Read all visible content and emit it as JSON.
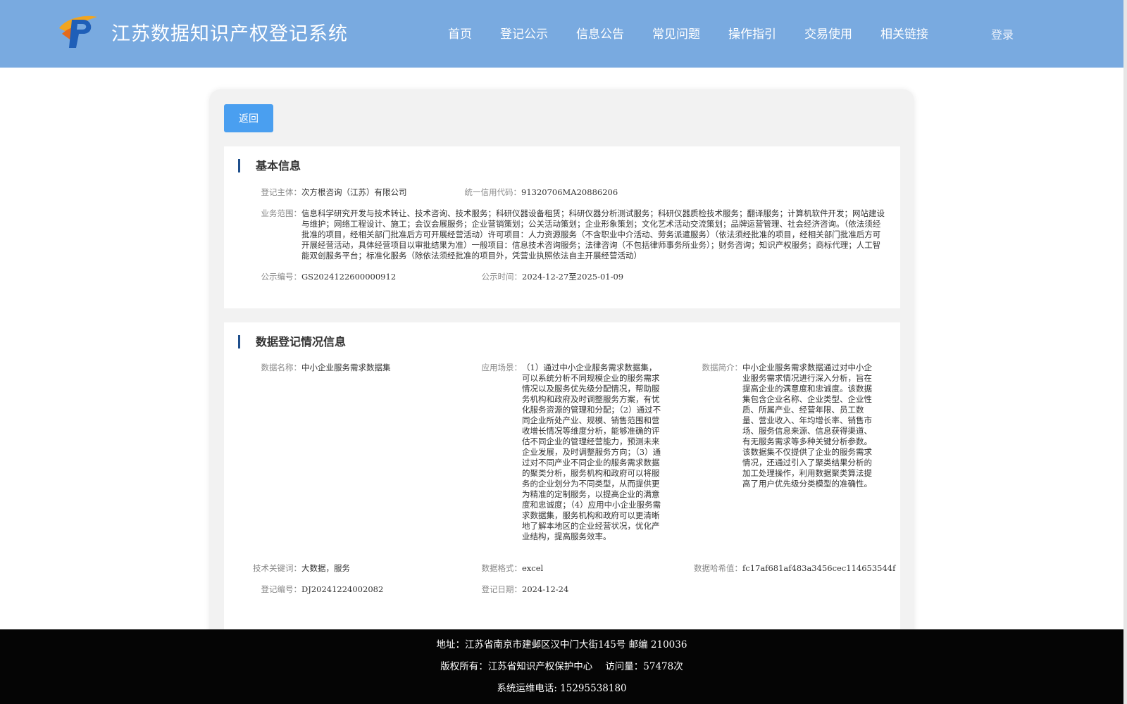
{
  "header": {
    "site_title": "江苏数据知识产权登记系统",
    "nav": [
      "首页",
      "登记公示",
      "信息公告",
      "常见问题",
      "操作指引",
      "交易使用",
      "相关链接"
    ],
    "login_label": "登录"
  },
  "actions": {
    "back_label": "返回"
  },
  "basic_info": {
    "title": "基本信息",
    "entity_label": "登记主体：",
    "entity_value": "次方根咨询（江苏）有限公司",
    "credit_code_label": "统一信用代码：",
    "credit_code_value": "91320706MA20886206",
    "scope_label": "业务范围：",
    "scope_value": "信息科学研究开发与技术转让、技术咨询、技术服务；科研仪器设备租赁；科研仪器分析测试服务；科研仪器质检技术服务；翻译服务；计算机软件开发；网站建设与维护；网络工程设计、施工；会议会展服务；企业营销策划；公关活动策划；企业形象策划；文化艺术活动交流策划；品牌运营管理、社会经济咨询。（依法须经批准的项目，经相关部门批准后方可开展经营活动）许可项目：人力资源服务（不含职业中介活动、劳务派遣服务）（依法须经批准的项目，经相关部门批准后方可开展经营活动，具体经营项目以审批结果为准）一般项目：信息技术咨询服务；法律咨询（不包括律师事务所业务）；财务咨询；知识产权服务；商标代理；人工智能双创服务平台；标准化服务（除依法须经批准的项目外，凭营业执照依法自主开展经营活动）",
    "notice_no_label": "公示编号：",
    "notice_no_value": "GS2024122600000912",
    "notice_time_label": "公示时间：",
    "notice_time_value": "2024-12-27至2025-01-09"
  },
  "data_info": {
    "title": "数据登记情况信息",
    "name_label": "数据名称：",
    "name_value": "中小企业服务需求数据集",
    "scenario_label": "应用场景：",
    "scenario_value": "（1）通过中小企业服务需求数据集，可以系统分析不同规模企业的服务需求情况以及服务优先级分配情况，帮助服务机构和政府及时调整服务方案，有忧化服务资源的管理和分配；（2）通过不同企业所处产业、规模、销售范围和营收增长情况等维度分析，能够准确的评估不同企业的管理经营能力，预测未来企业发展，及时调整服务方向；（3）通过对不同产业不同企业的服务需求数据的聚类分析，服务机构和政府可以将服务的企业划分为不同类型，从而提供更为精准的定制服务，以提高企业的满意度和忠诚度；（4）应用中小企业服务需求数据集，服务机构和政府可以更清晰地了解本地区的企业经营状况，优化产业结构，提高服务效率。",
    "intro_label": "数据简介：",
    "intro_value": "中小企业服务需求数据通过对中小企业服务需求情况进行深入分析，旨在提高企业的满意度和忠诚度。该数据集包含企业名称、企业类型、企业性质、所属产业、经营年限、员工数量、营业收入、年均增长率、销售市场、服务信息来源、信息获得渠道、有无服务需求等多种关键分析参数。该数据集不仅提供了企业的服务需求情况，还通过引入了聚类结果分析的加工处理操作，利用数据聚类算法提高了用户优先级分类模型的准确性。",
    "keywords_label": "技术关键词：",
    "keywords_value": "大数据，服务",
    "format_label": "数据格式：",
    "format_value": "excel",
    "hash_label": "数据哈希值：",
    "hash_value": "fc17af681af483a3456cec114653544f",
    "reg_no_label": "登记编号：",
    "reg_no_value": "DJ20241224002082",
    "reg_date_label": "登记日期：",
    "reg_date_value": "2024-12-24"
  },
  "footer": {
    "address": "地址：江苏省南京市建邺区汉中门大街145号 邮编 210036",
    "copyright": "版权所有：江苏省知识产权保护中心",
    "visits": "访问量：57478次",
    "phone": "系统运维电话: 15295538180"
  },
  "colors": {
    "header_bg": "#79aae0",
    "button_bg": "#4a9ff0",
    "section_bar": "#1f4f8c",
    "footer_bg": "#050505"
  },
  "icons": {
    "logo": "ip-logo-icon"
  }
}
